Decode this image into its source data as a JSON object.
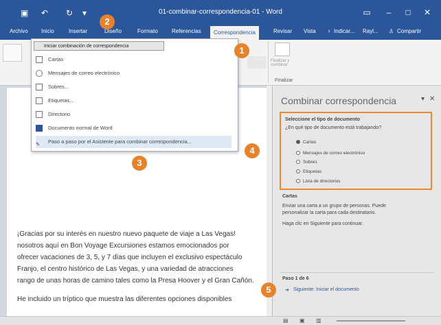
{
  "window": {
    "title": "01-combinar-correspondencia-01 - Word"
  },
  "tabs": [
    "Archivo",
    "Inicio",
    "Insertar",
    "Diseño",
    "Formato",
    "Referencias",
    "Correspondencia",
    "Revisar",
    "Vista"
  ],
  "tell_me": "Indicar...",
  "user": "Rayl...",
  "share": "Compartir",
  "ribbon": {
    "start_merge_label": "Iniciar combinación de correspondencia",
    "finish_label": "Finalizar y combinar",
    "group_label": "Finalizar"
  },
  "dropdown": {
    "items": [
      "Cartas",
      "Mensajes de correo electrónico",
      "Sobres...",
      "Etiquetas...",
      "Directorio",
      "Documento normal de Word",
      "Paso a paso por el Asistente para combinar correspondencia..."
    ]
  },
  "pane": {
    "title": "Combinar correspondencia",
    "section_title": "Seleccione el tipo de documento",
    "question": "¿En qué tipo de documento está trabajando?",
    "options": [
      "Cartas",
      "Mensajes de correo electrónico",
      "Sobres",
      "Etiquetas",
      "Lista de directorios"
    ],
    "selected_index": 0,
    "desc_title": "Cartas",
    "desc_lines": [
      "Enviar una carta a un grupo de personas. Puede",
      "personalizar la carta para cada destinatario.",
      "Haga clic en Siguiente para continuar."
    ],
    "step": "Paso 1 de 6",
    "next_link": "Siguiente: Iniciar el documento"
  },
  "document": {
    "lines": [
      "¡Gracias por su interés en nuestro nuevo paquete de viaje a Las Vegas!",
      "nosotros aquí en Bon Voyage Excursiones estamos emocionados por",
      "ofrecer vacaciones de 3, 5, y 7 días que incluyen el exclusivo espectáculo",
      "Franjo, el centro histórico de Las Vegas, y una variedad de atracciones",
      "rango de unas horas de camino tales como la Presa Hoover y el Gran Cañón.",
      "",
      "He incluido un tríptico que muestra las diferentes opciones disponibles"
    ]
  },
  "callouts": [
    "1",
    "2",
    "3",
    "4",
    "5"
  ],
  "colors": {
    "accent": "#2b579a",
    "callout": "#e8822a"
  }
}
